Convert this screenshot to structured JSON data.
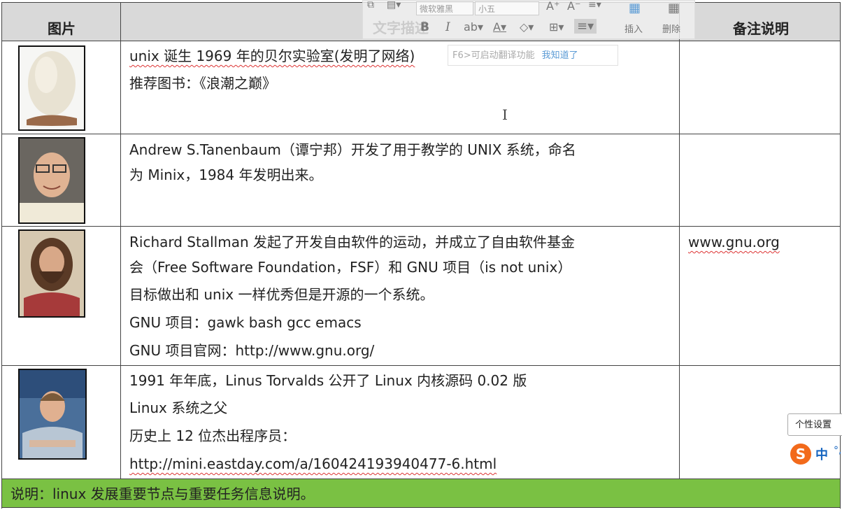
{
  "header": {
    "col_image": "图片",
    "col_desc": "文字描述",
    "col_note": "备注说明"
  },
  "rows": [
    {
      "lines": [
        "unix 诞生 1969 年的贝尔实验室(发明了网络)",
        "推荐图书：《浪潮之巅》"
      ],
      "note": ""
    },
    {
      "lines": [
        "Andrew S.Tanenbaum（谭宁邦）开发了用于教学的 UNIX 系统，命名",
        "为 Minix，1984 年发明出来。"
      ],
      "note": ""
    },
    {
      "lines": [
        "Richard Stallman 发起了开发自由软件的运动，并成立了自由软件基金",
        "会（Free Software Foundation，FSF）和 GNU 项目（is not unix）",
        "目标做出和 unix 一样优秀但是开源的一个系统。",
        "GNU 项目：gawk bash gcc emacs",
        "GNU 项目官网：http://www.gnu.org/"
      ],
      "note": "www.gnu.org"
    },
    {
      "lines": [
        "1991 年年底，Linus Torvalds 公开了 Linux 内核源码 0.02 版",
        "Linux 系统之父",
        "历史上 12 位杰出程序员：",
        "http://mini.eastday.com/a/160424193940477-6.html"
      ],
      "note": ""
    }
  ],
  "footer": "说明：linux 发展重要节点与重要任务信息说明。",
  "toolbar": {
    "font_name": "微软雅黑",
    "font_size": "小五",
    "insert_label": "插入",
    "delete_label": "删除",
    "tip_text": "F6>可启动翻译功能",
    "tip_link": "我知道了"
  },
  "ime": {
    "tooltip": "个性设置",
    "mode": "中"
  }
}
